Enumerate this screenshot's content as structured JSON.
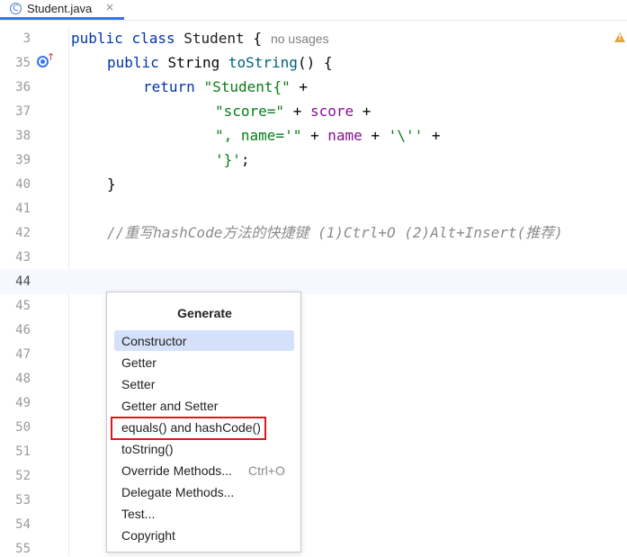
{
  "tab": {
    "icon_glyph": "C",
    "filename": "Student.java",
    "close_glyph": "×"
  },
  "lines": [
    {
      "num": "3"
    },
    {
      "num": "35"
    },
    {
      "num": "36"
    },
    {
      "num": "37"
    },
    {
      "num": "38"
    },
    {
      "num": "39"
    },
    {
      "num": "40"
    },
    {
      "num": "41"
    },
    {
      "num": "42"
    },
    {
      "num": "43"
    },
    {
      "num": "44"
    },
    {
      "num": "45"
    },
    {
      "num": "46"
    },
    {
      "num": "47"
    },
    {
      "num": "48"
    },
    {
      "num": "49"
    },
    {
      "num": "50"
    },
    {
      "num": "51"
    },
    {
      "num": "52"
    },
    {
      "num": "53"
    },
    {
      "num": "54"
    },
    {
      "num": "55"
    }
  ],
  "code": {
    "l3": {
      "kw1": "public",
      "kw2": "class",
      "cls": "Student",
      "brace": "{",
      "hint": "no usages"
    },
    "l35": {
      "kw1": "public",
      "type": "String",
      "fn": "toString",
      "rest": "() {"
    },
    "l36": {
      "kw": "return",
      "str": "\"Student{\"",
      "op": " +"
    },
    "l37": {
      "str": "\"score=\"",
      "op1": " + ",
      "fld": "score",
      "op2": " +"
    },
    "l38": {
      "str1": "\", name='\"",
      "op1": " + ",
      "fld": "name",
      "op2": " + ",
      "str2": "'\\''",
      "op3": " +"
    },
    "l39": {
      "str": "'}'",
      "op": ";"
    },
    "l40": {
      "brace": "}"
    },
    "l42": {
      "comment": "//重写hashCode方法的快捷键 (1)Ctrl+O (2)Alt+Insert(推荐)"
    }
  },
  "popup": {
    "title": "Generate",
    "items": [
      {
        "label": "Constructor",
        "shortcut": "",
        "selected": true
      },
      {
        "label": "Getter",
        "shortcut": ""
      },
      {
        "label": "Setter",
        "shortcut": ""
      },
      {
        "label": "Getter and Setter",
        "shortcut": ""
      },
      {
        "label": "equals() and hashCode()",
        "shortcut": "",
        "highlighted": true
      },
      {
        "label": "toString()",
        "shortcut": ""
      },
      {
        "label": "Override Methods...",
        "shortcut": "Ctrl+O"
      },
      {
        "label": "Delegate Methods...",
        "shortcut": ""
      },
      {
        "label": "Test...",
        "shortcut": ""
      },
      {
        "label": "Copyright",
        "shortcut": ""
      }
    ]
  },
  "colors": {
    "keyword": "#0033b3",
    "method": "#00627a",
    "string": "#067d17",
    "field": "#871094",
    "comment": "#8c8c8c",
    "selection": "#d5e1fa",
    "highlight_box": "#e0161e"
  },
  "icons": {
    "file": "java-class-icon",
    "override": "override-method-icon",
    "warning": "warning-icon"
  }
}
